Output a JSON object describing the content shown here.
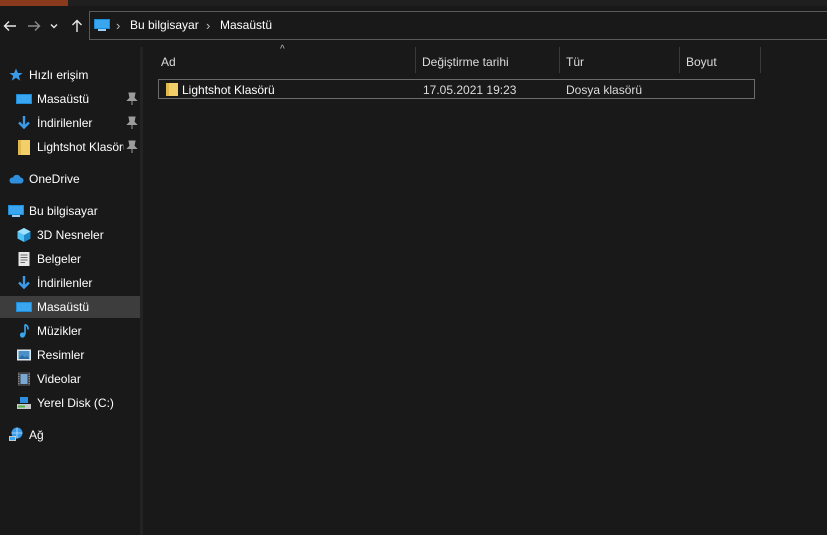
{
  "navigation": {
    "back_icon": "arrow-left-icon",
    "forward_icon": "arrow-right-icon",
    "recent_icon": "chevron-down-icon",
    "up_icon": "arrow-up-icon"
  },
  "address_bar": {
    "crumbs": [
      "Bu bilgisayar",
      "Masaüstü"
    ]
  },
  "sidebar": {
    "quick_access": "Hızlı erişim",
    "quick_items": [
      {
        "label": "Masaüstü",
        "icon": "desktop-icon",
        "pinned": true
      },
      {
        "label": "İndirilenler",
        "icon": "download-icon",
        "pinned": true
      },
      {
        "label": "Lightshot Klasörü",
        "icon": "folder-icon",
        "pinned": true
      }
    ],
    "onedrive": "OneDrive",
    "this_pc": "Bu bilgisayar",
    "pc_items": [
      {
        "label": "3D Nesneler",
        "icon": "3d-objects-icon"
      },
      {
        "label": "Belgeler",
        "icon": "documents-icon"
      },
      {
        "label": "İndirilenler",
        "icon": "download-icon"
      },
      {
        "label": "Masaüstü",
        "icon": "desktop-icon",
        "selected": true
      },
      {
        "label": "Müzikler",
        "icon": "music-icon"
      },
      {
        "label": "Resimler",
        "icon": "pictures-icon"
      },
      {
        "label": "Videolar",
        "icon": "videos-icon"
      },
      {
        "label": "Yerel Disk (C:)",
        "icon": "local-disk-icon"
      }
    ],
    "network": "Ağ"
  },
  "file_list": {
    "columns": [
      "Ad",
      "Değiştirme tarihi",
      "Tür",
      "Boyut"
    ],
    "rows": [
      {
        "name": "Lightshot Klasörü",
        "date": "17.05.2021 19:23",
        "type": "Dosya klasörü",
        "size": ""
      }
    ]
  },
  "colors": {
    "background": "#191919",
    "selection": "#3d3d3d",
    "folder": "#f3cf6a",
    "accent_blue": "#1e8bd6",
    "title_accent": "#8a3a1c"
  }
}
